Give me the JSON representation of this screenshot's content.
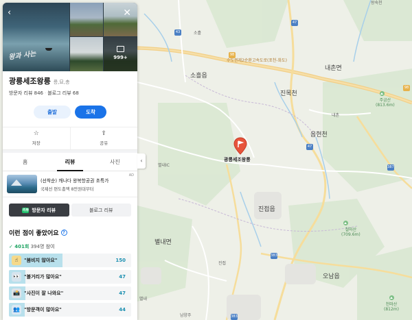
{
  "place": {
    "name": "광릉세조왕릉",
    "category": "릉,묘,총",
    "visitor_reviews": "방문자 리뷰 846",
    "blog_reviews": "블로그 리뷰 68",
    "photo_more_count": "999+",
    "poster_text": "왕과 사는"
  },
  "actions": {
    "departure": "출발",
    "arrival": "도착",
    "save": "저장",
    "share": "공유"
  },
  "tabs": [
    {
      "label": "홈",
      "active": false
    },
    {
      "label": "리뷰",
      "active": true
    },
    {
      "label": "사진",
      "active": false
    }
  ],
  "ad": {
    "title": "(선착순) 캐나다 왕복항공권 초특가",
    "subtitle": "국제선 편도총액 8만원대부터",
    "tag": "AD"
  },
  "review_toggle": {
    "visitor": "방문자 리뷰",
    "blog": "블로그 리뷰",
    "badge": "리뷰"
  },
  "keywords": {
    "title": "이런 점이 좋았어요",
    "help": "?",
    "count": "✓ 401회",
    "participants": "394명 참여",
    "items": [
      {
        "emoji": "☝",
        "label": "\"붐비지 않아요\"",
        "value": "150",
        "fill": 1.0
      },
      {
        "emoji": "👀",
        "label": "\"볼거리가 많아요\"",
        "value": "47",
        "fill": 0.31
      },
      {
        "emoji": "📸",
        "label": "\"사진이 잘 나와요\"",
        "value": "47",
        "fill": 0.31
      },
      {
        "emoji": "👥",
        "label": "\"방문객이 많아요\"",
        "value": "44",
        "fill": 0.29
      }
    ]
  },
  "map": {
    "pin_label": "광릉세조왕릉",
    "labels": {
      "soheul": "소흘읍",
      "jinjeop": "진접읍",
      "naechon": "내촌면",
      "byeollae": "별내면",
      "onam": "오남읍",
      "jinmok": "진목천",
      "eumhyeon": "음현천",
      "wangsuk": "왕숙천",
      "road_98": "98",
      "road_name": "수도권제2순환고속도로(포천-화도)",
      "sonuk": "소흘",
      "naechon_ic": "내촌",
      "jujeopsan": "주금산\n(813.6m)",
      "cheolmasan": "철마산\n(709.6m)",
      "cheonmasan": "천마산\n(812m)",
      "byeolnae_ic": "별내IC",
      "namyang": "남양주",
      "jinjeop_ic": "진접",
      "jinjeop2": "진접2",
      "gwangneung": "광릉내",
      "namyang_ic": "남양주",
      "byeolnae": "별내",
      "hwado": "화도",
      "jinjeop_jct": "진접JCT",
      "byeollae_ic2": "별내IC"
    },
    "shields": [
      "43",
      "47",
      "47",
      "387",
      "383",
      "383",
      "98",
      "98"
    ]
  },
  "colors": {
    "accent": "#1a73e8",
    "green": "#1fc16b",
    "pin": "#e7543b"
  }
}
